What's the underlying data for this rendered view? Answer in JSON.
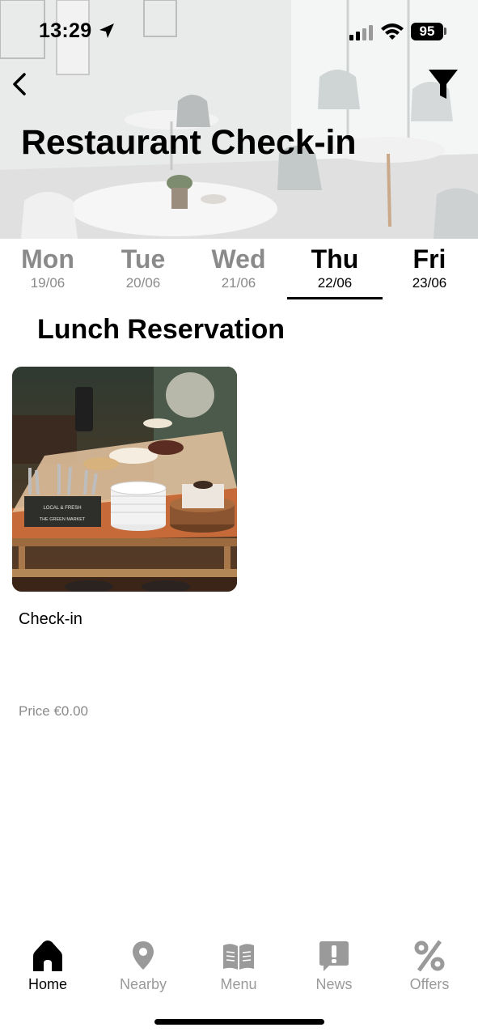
{
  "status_bar": {
    "time": "13:29",
    "battery": "95"
  },
  "header": {
    "title": "Restaurant Check-in"
  },
  "days": [
    {
      "name": "Mon",
      "date": "19/06"
    },
    {
      "name": "Tue",
      "date": "20/06"
    },
    {
      "name": "Wed",
      "date": "21/06"
    },
    {
      "name": "Thu",
      "date": "22/06",
      "selected": true
    },
    {
      "name": "Fri",
      "date": "23/06"
    }
  ],
  "section": {
    "title": "Lunch Reservation"
  },
  "card": {
    "image_text_1": "LOCAL & FRESH",
    "image_text_2": "THE GREEN MARKET",
    "label": "Check-in",
    "price": "Price €0.00"
  },
  "tabs": [
    {
      "label": "Home",
      "icon": "home-icon",
      "active": true
    },
    {
      "label": "Nearby",
      "icon": "location-pin-icon"
    },
    {
      "label": "Menu",
      "icon": "book-icon"
    },
    {
      "label": "News",
      "icon": "exclamation-icon"
    },
    {
      "label": "Offers",
      "icon": "percent-icon"
    }
  ],
  "colors": {
    "active": "#000000",
    "inactive": "#8a8a8a"
  }
}
